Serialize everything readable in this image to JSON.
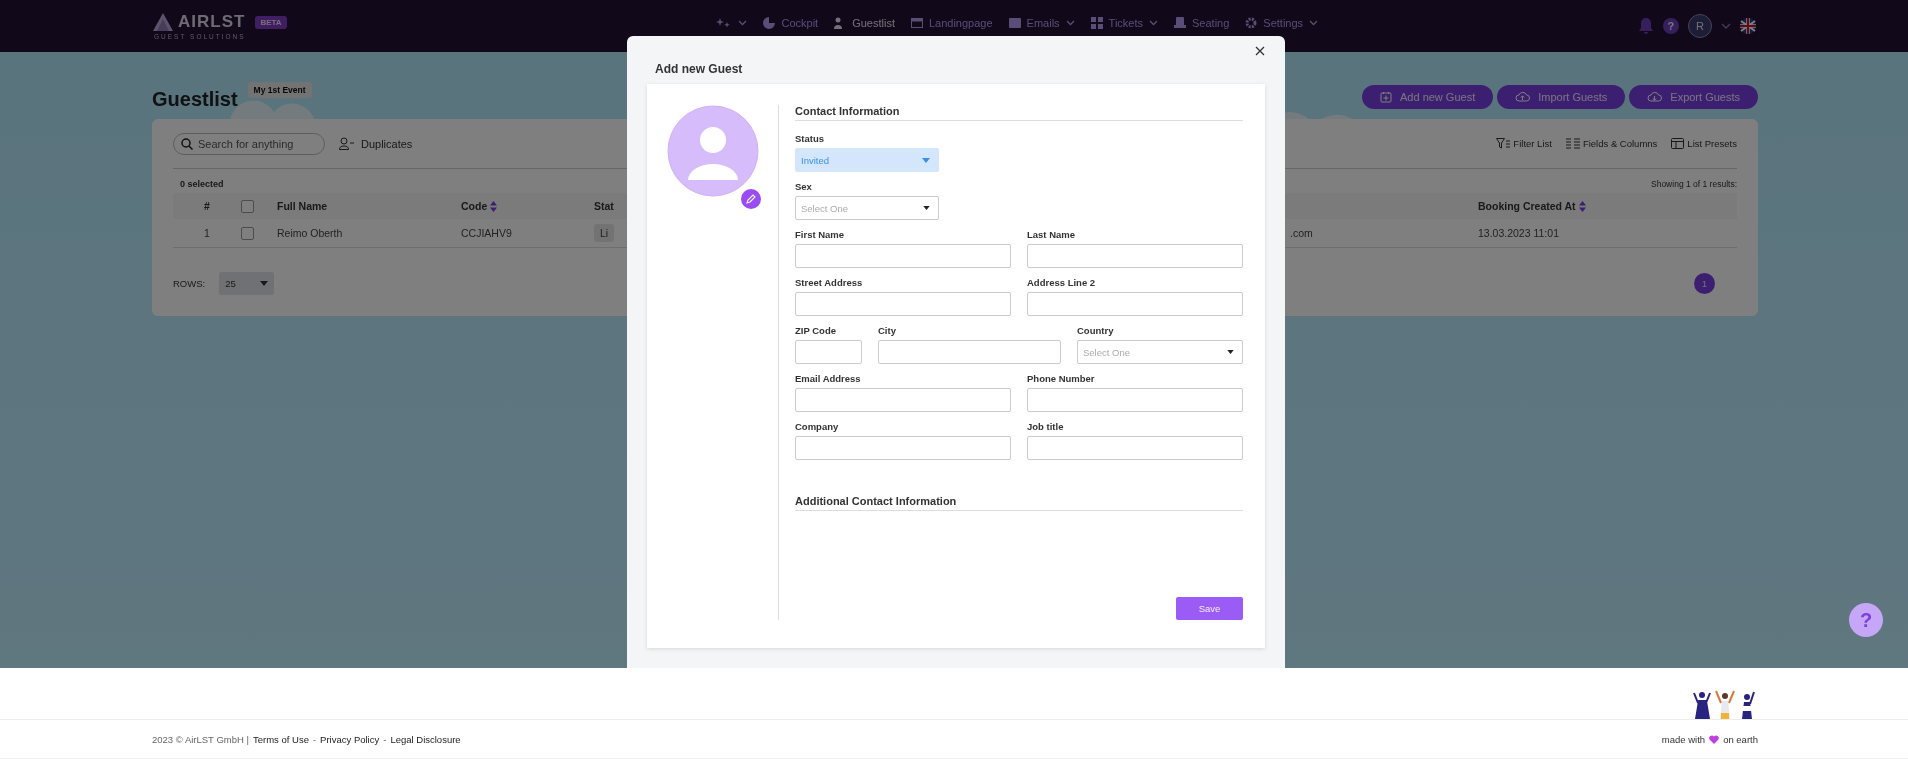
{
  "header": {
    "logo": "AIRLST",
    "logo_badge": "BETA",
    "tagline": "GUEST SOLUTIONS",
    "nav": [
      {
        "kind": "icon",
        "dropdown": true,
        "selected": false
      },
      {
        "kind": "link",
        "label": "Cockpit",
        "dropdown": false,
        "selected": false
      },
      {
        "kind": "link",
        "label": "Guestlist",
        "dropdown": false,
        "selected": true
      },
      {
        "kind": "link",
        "label": "Landingpage",
        "dropdown": false,
        "selected": false
      },
      {
        "kind": "link",
        "label": "Emails",
        "dropdown": true,
        "selected": false
      },
      {
        "kind": "link",
        "label": "Tickets",
        "dropdown": true,
        "selected": false
      },
      {
        "kind": "link",
        "label": "Seating",
        "dropdown": false,
        "selected": false
      },
      {
        "kind": "link",
        "label": "Settings",
        "dropdown": true,
        "selected": false
      }
    ],
    "help": "?",
    "avatar": "R"
  },
  "page": {
    "title": "Guestlist",
    "event": "My 1st Event",
    "actions": [
      "Add new Guest",
      "Import Guests",
      "Export Guests"
    ]
  },
  "list": {
    "search_placeholder": "Search for anything",
    "duplicates": "Duplicates",
    "tools": [
      "Filter List",
      "Fields & Columns",
      "List Presets"
    ],
    "selection": "0 selected",
    "results": "Showing 1 of 1 results:",
    "columns": {
      "number": "#",
      "checked": false,
      "full_name": "Full Name",
      "code": "Code",
      "code_sortable": true,
      "column_5": "Stat",
      "booking_created_at": "Booking Created At",
      "booking_sortable": true
    },
    "rows": [
      {
        "number": "1",
        "checked": false,
        "full_name": "Reimo Oberth",
        "code": "CCJIAHV9",
        "column_5": "Li",
        "column_6": ".com",
        "booking_created_at": "13.03.2023 11:01"
      }
    ],
    "rows_label": "ROWS:",
    "rows_per_page": "25",
    "pages": [
      {
        "label": "1",
        "selected": true
      }
    ]
  },
  "modal": {
    "title": "Add new Guest",
    "contact_heading": "Contact Information",
    "field_rows": [
      [
        {
          "kind": "select",
          "label": "Status",
          "value": "Invited"
        }
      ],
      [
        {
          "kind": "select",
          "label": "Sex",
          "placeholder": "Select One"
        }
      ],
      [
        {
          "kind": "input",
          "label": "First Name"
        },
        {
          "kind": "input",
          "label": "Last Name"
        }
      ],
      [
        {
          "kind": "input",
          "label": "Street Address"
        },
        {
          "kind": "input",
          "label": "Address Line 2"
        }
      ],
      [
        {
          "kind": "input",
          "label": "ZIP Code"
        },
        {
          "kind": "input",
          "label": "City"
        },
        {
          "kind": "select",
          "label": "Country",
          "placeholder": "Select One"
        }
      ],
      [
        {
          "kind": "input",
          "label": "Email Address"
        },
        {
          "kind": "input",
          "label": "Phone Number"
        }
      ],
      [
        {
          "kind": "input",
          "label": "Company"
        },
        {
          "kind": "input",
          "label": "Job title"
        }
      ]
    ],
    "additional_heading": "Additional Contact Information",
    "save": "Save"
  },
  "help_button": "?",
  "footer": {
    "parts": [
      {
        "kind": "text",
        "text": "2023 © AirLST GmbH |"
      },
      {
        "kind": "link",
        "text": "Terms of Use"
      },
      {
        "kind": "text",
        "text": "-"
      },
      {
        "kind": "link",
        "text": "Privacy Policy"
      },
      {
        "kind": "text",
        "text": "-"
      },
      {
        "kind": "link",
        "text": "Legal Disclosure"
      }
    ],
    "made_with": "made with",
    "on_earth": "on earth"
  }
}
